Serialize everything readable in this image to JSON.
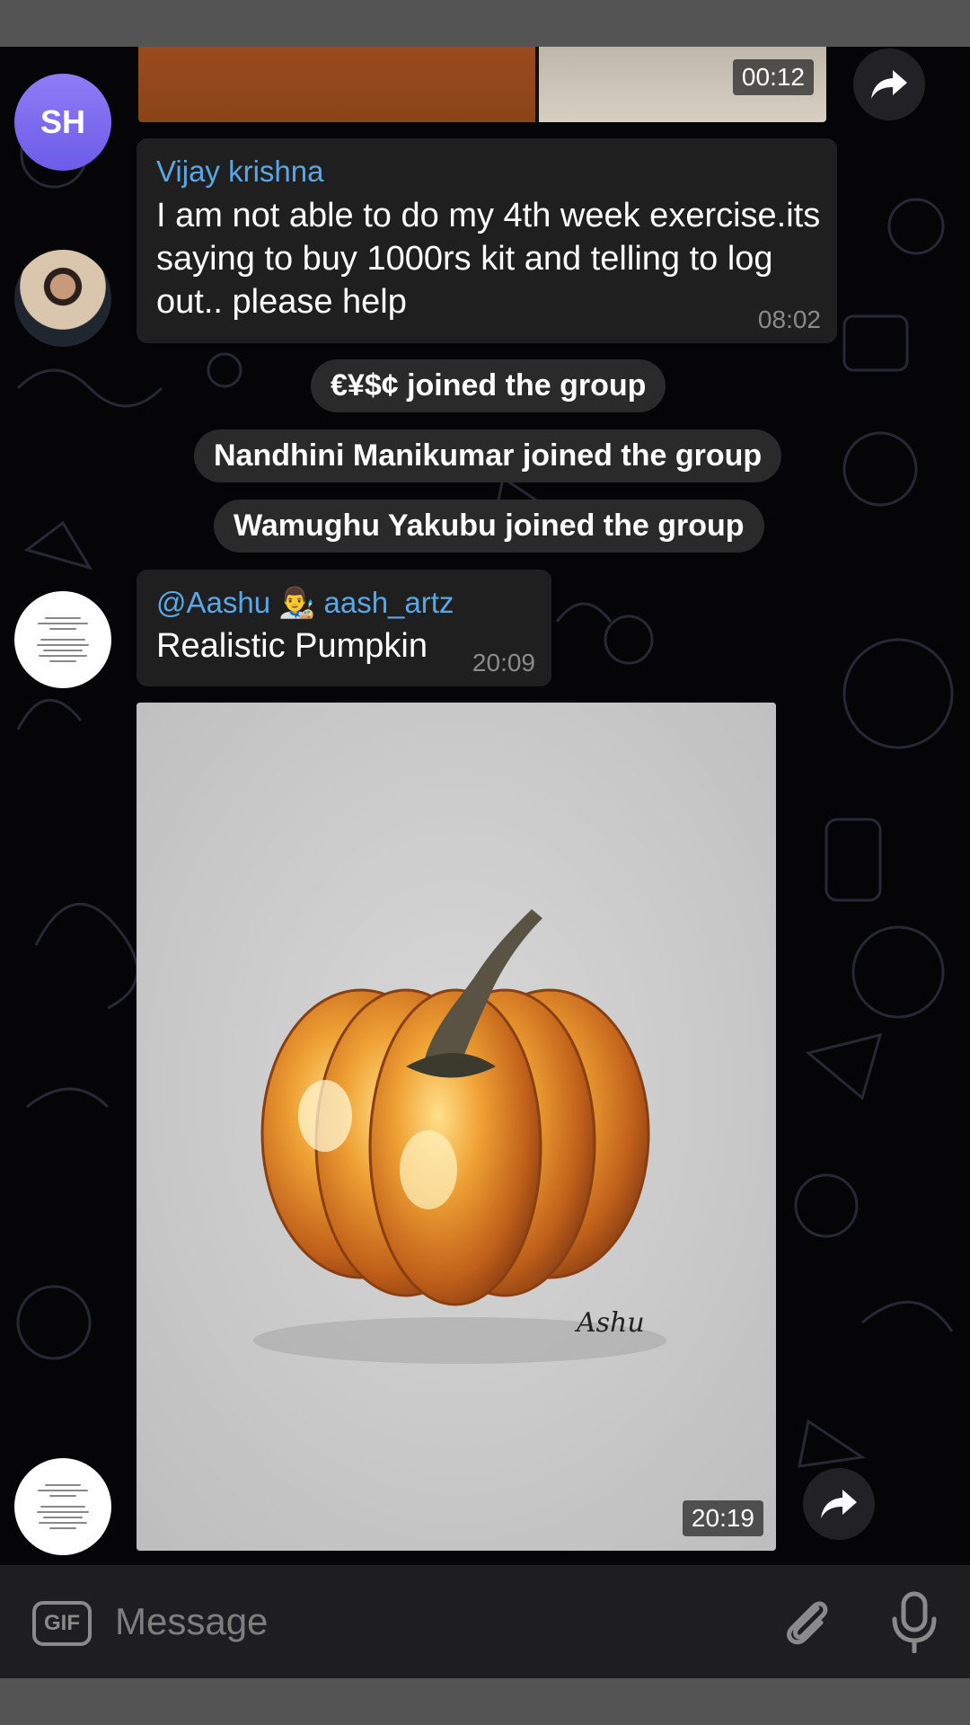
{
  "top_media": {
    "duration": "00:12"
  },
  "messages": {
    "sh_avatar": {
      "initials": "SH"
    },
    "vijay": {
      "sender": "Vijay krishna",
      "text": "I am not able to do my 4th week exercise.its saying to buy 1000rs kit and telling to log out.. please help",
      "time": "08:02"
    },
    "service": [
      {
        "text": "€¥$¢ joined the group"
      },
      {
        "text": "Nandhini Manikumar joined the group"
      },
      {
        "text": "Wamughu Yakubu joined the group"
      }
    ],
    "aashu": {
      "sender": "@Aashu 👨‍🎨 aash_artz",
      "text": "Realistic Pumpkin",
      "time": "20:09"
    },
    "photo": {
      "duration": "20:19",
      "signature": "Ashu"
    }
  },
  "composer": {
    "placeholder": "Message",
    "gif_label": "GIF"
  },
  "colors": {
    "sender_name": "#5aa7e8",
    "bubble": "#1f1f1f",
    "sh_avatar": "#7b6cf0"
  },
  "icons": [
    "forward-icon",
    "gif-icon",
    "attach-icon",
    "mic-icon"
  ]
}
